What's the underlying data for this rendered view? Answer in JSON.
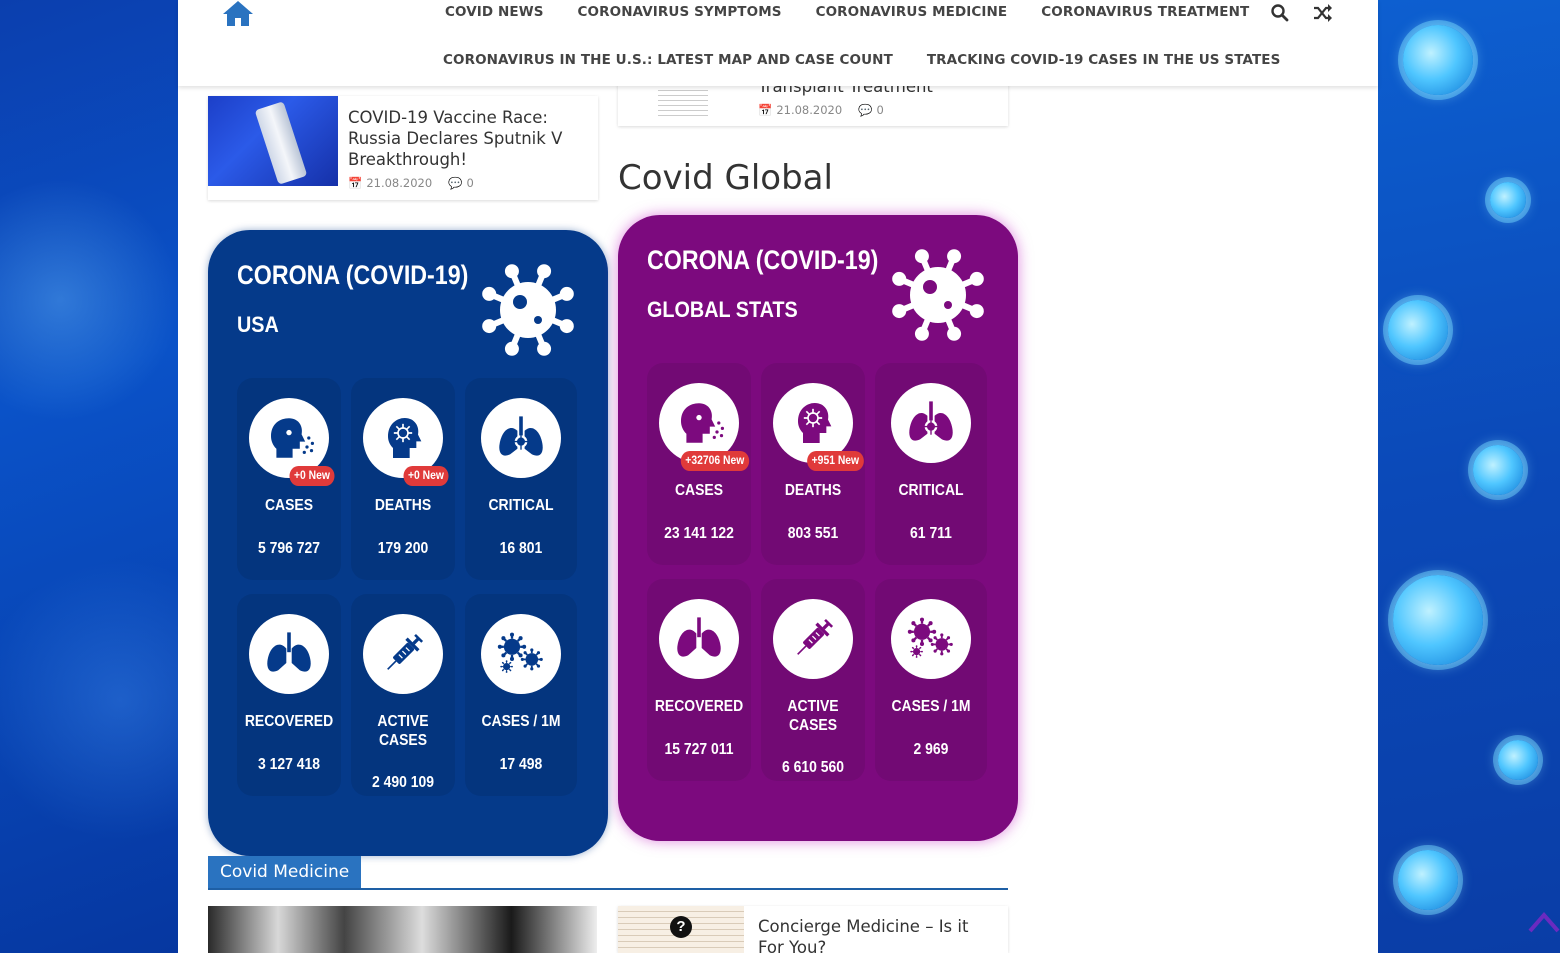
{
  "nav": {
    "row1": [
      "COVID NEWS",
      "CORONAVIRUS SYMPTOMS",
      "CORONAVIRUS MEDICINE",
      "CORONAVIRUS TREATMENT"
    ],
    "row2": [
      "CORONAVIRUS IN THE U.S.: LATEST MAP AND CASE COUNT",
      "TRACKING COVID-19 CASES IN THE US STATES"
    ]
  },
  "posts": {
    "vaccine": {
      "title": "COVID-19 Vaccine Race: Russia Declares Sputnik V Breakthrough!",
      "date": "21.08.2020",
      "comments": "0"
    },
    "transplant": {
      "title": "Transplant Treatment",
      "date": "21.08.2020",
      "comments": "0"
    },
    "concierge": {
      "title": "Concierge Medicine – Is it For You?"
    }
  },
  "section_title": "Covid Global",
  "usa": {
    "title": "CORONA (COVID-19)",
    "subtitle": "USA",
    "tiles": [
      {
        "label": "CASES",
        "value": "5 796 727",
        "badge": "+0 New",
        "icon": "cough-head-icon"
      },
      {
        "label": "DEATHS",
        "value": "179 200",
        "badge": "+0 New",
        "icon": "virus-head-icon"
      },
      {
        "label": "CRITICAL",
        "value": "16 801",
        "icon": "infected-lungs-icon"
      },
      {
        "label": "RECOVERED",
        "value": "3 127 418",
        "icon": "lungs-icon"
      },
      {
        "label": "ACTIVE CASES",
        "value": "2 490 109",
        "icon": "syringe-icon"
      },
      {
        "label": "CASES / 1M",
        "value": "17 498",
        "icon": "viruses-icon"
      }
    ]
  },
  "global": {
    "title": "CORONA (COVID-19)",
    "subtitle": "GLOBAL STATS",
    "tiles": [
      {
        "label": "CASES",
        "value": "23 141 122",
        "badge": "+32706 New",
        "icon": "cough-head-icon"
      },
      {
        "label": "DEATHS",
        "value": "803 551",
        "badge": "+951 New",
        "icon": "virus-head-icon"
      },
      {
        "label": "CRITICAL",
        "value": "61 711",
        "icon": "infected-lungs-icon"
      },
      {
        "label": "RECOVERED",
        "value": "15 727 011",
        "icon": "lungs-icon"
      },
      {
        "label": "ACTIVE CASES",
        "value": "6 610 560",
        "icon": "syringe-icon"
      },
      {
        "label": "CASES / 1M",
        "value": "2 969",
        "icon": "viruses-icon"
      }
    ]
  },
  "category": {
    "label": "Covid Medicine"
  },
  "colors": {
    "usa_bg": "#053a8a",
    "global_bg": "#7c0a7e",
    "badge": "#e03a3a",
    "accent": "#2a73c0"
  }
}
